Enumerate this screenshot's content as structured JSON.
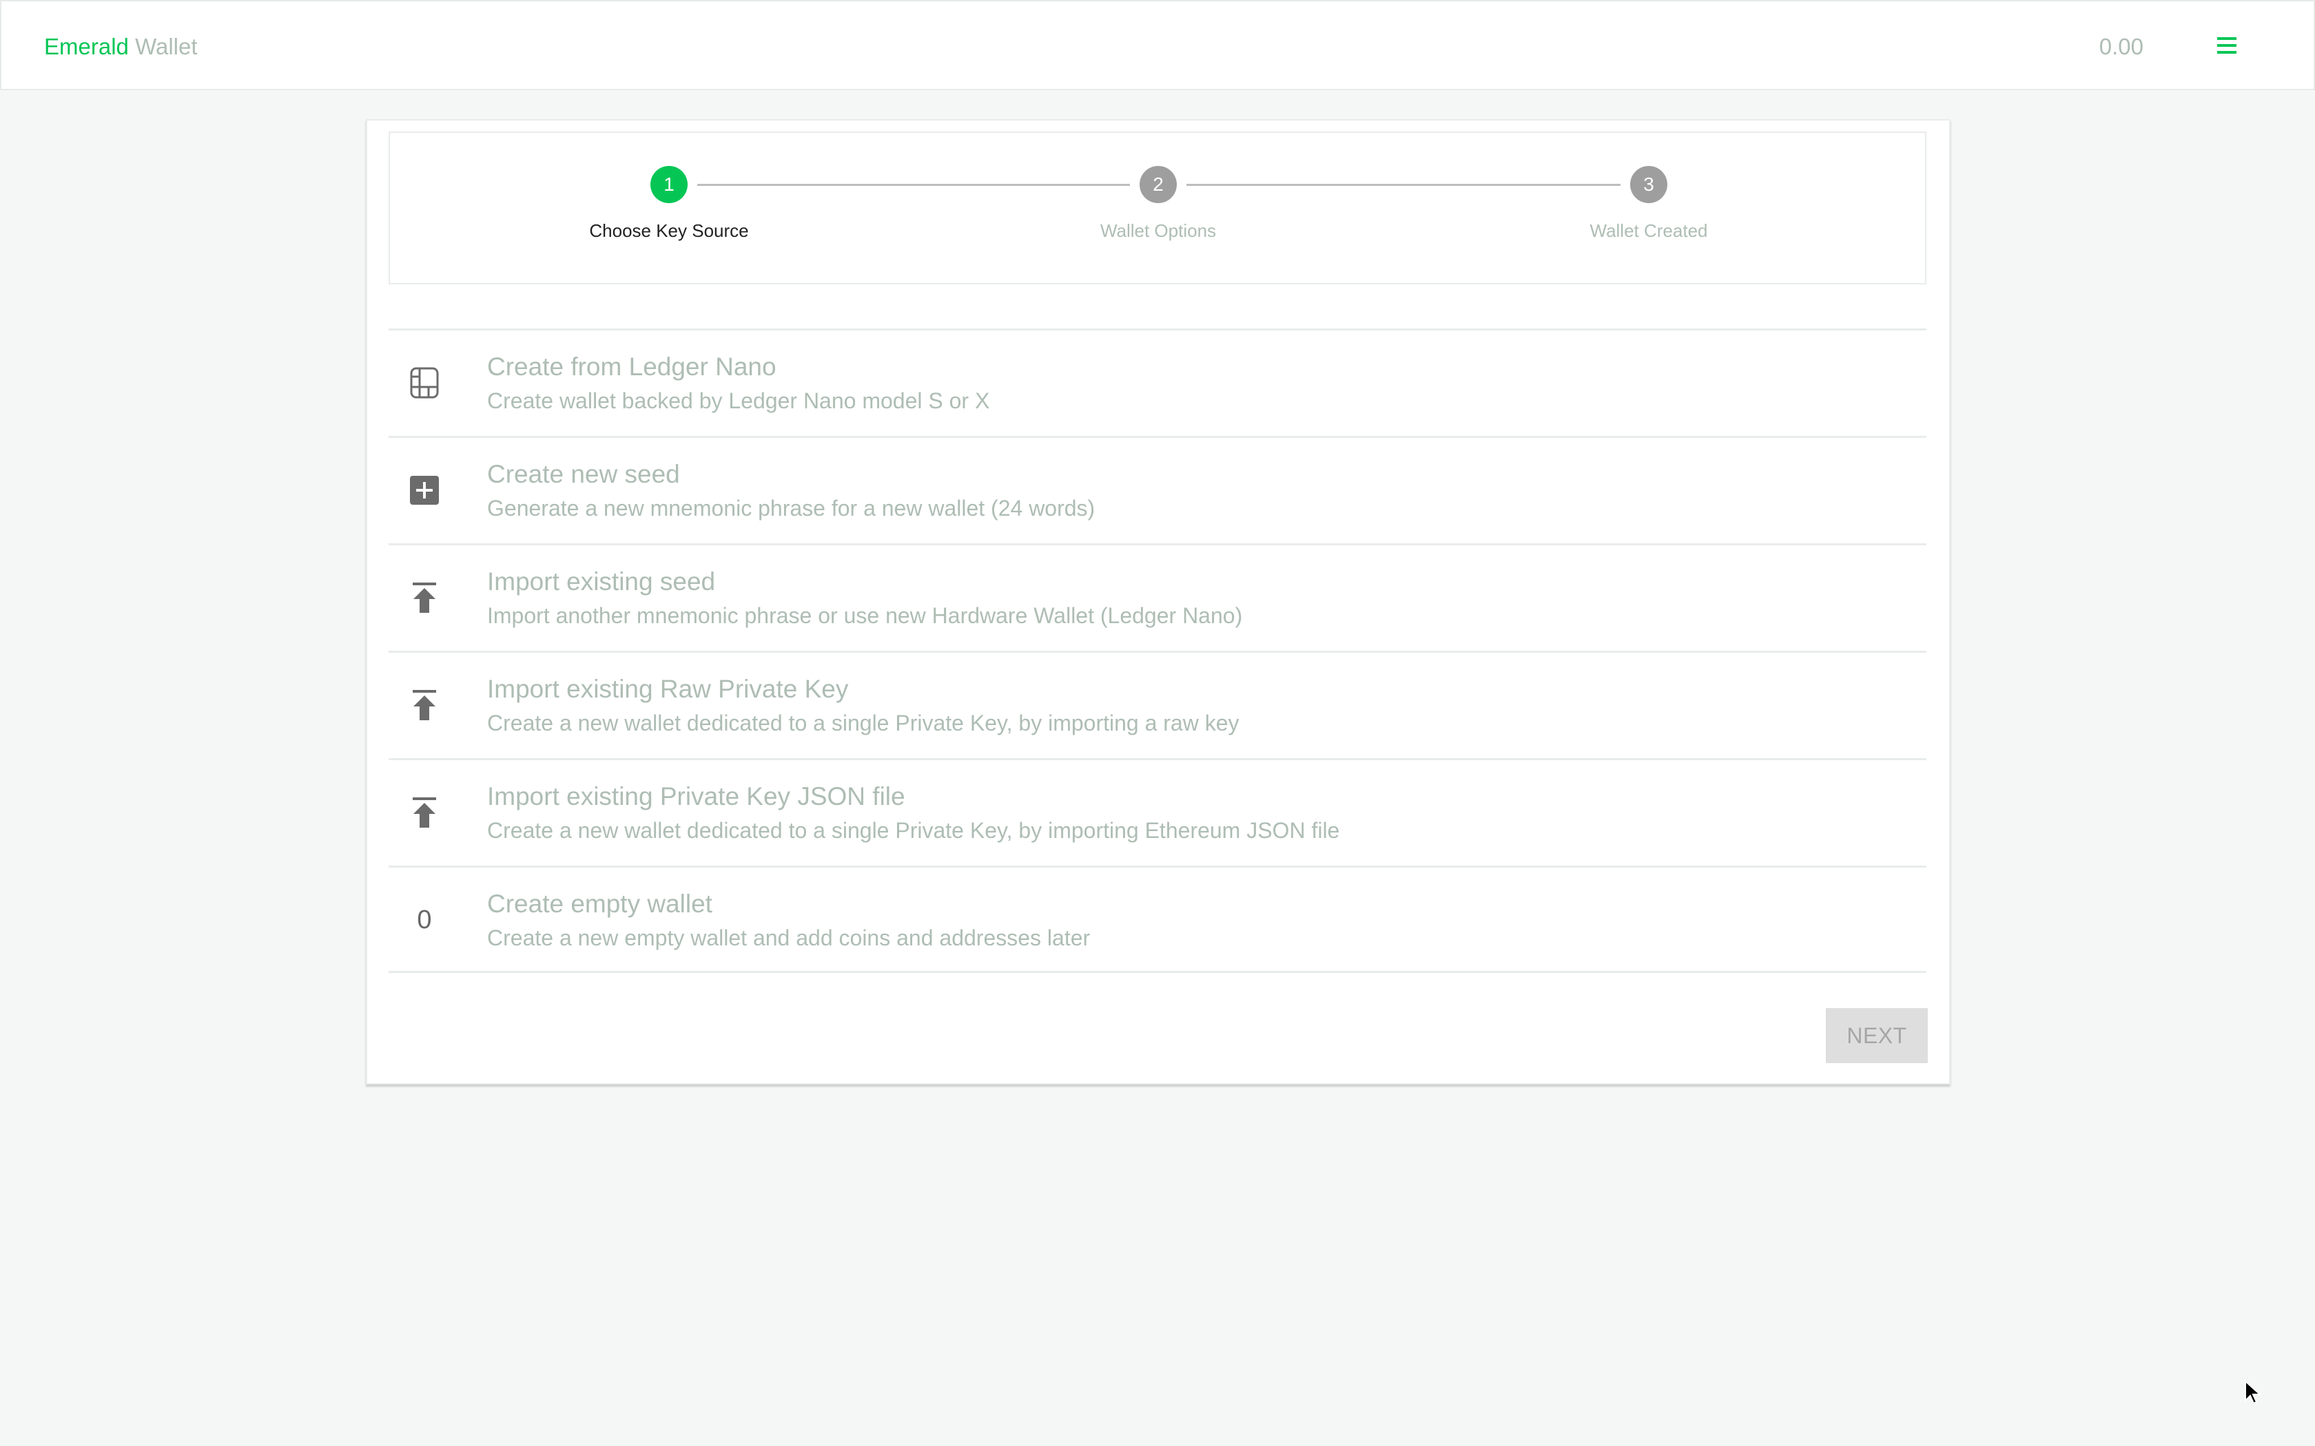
{
  "header": {
    "brand_primary": "Emerald",
    "brand_secondary": "Wallet",
    "balance": "0.00",
    "menu_icon": "hamburger-menu-icon"
  },
  "colors": {
    "accent": "#05c655",
    "muted_text": "#aebdb4",
    "step_inactive": "#9e9e9e",
    "icon": "#6b6b6b",
    "background": "#f5f7f6"
  },
  "stepper": {
    "active_step": 1,
    "steps": [
      {
        "number": "1",
        "label": "Choose Key Source",
        "active": true
      },
      {
        "number": "2",
        "label": "Wallet Options",
        "active": false
      },
      {
        "number": "3",
        "label": "Wallet Created",
        "active": false
      }
    ]
  },
  "options": [
    {
      "icon": "ledger-icon",
      "title": "Create from Ledger Nano",
      "description": "Create wallet backed by Ledger Nano model S or X"
    },
    {
      "icon": "add-box-icon",
      "title": "Create new seed",
      "description": "Generate a new mnemonic phrase for a new wallet (24 words)"
    },
    {
      "icon": "upload-icon",
      "title": "Import existing seed",
      "description": "Import another mnemonic phrase or use new Hardware Wallet (Ledger Nano)"
    },
    {
      "icon": "upload-icon",
      "title": "Import existing Raw Private Key",
      "description": "Create a new wallet dedicated to a single Private Key, by importing a raw key"
    },
    {
      "icon": "upload-icon",
      "title": "Import existing Private Key JSON file",
      "description": "Create a new wallet dedicated to a single Private Key, by importing Ethereum JSON file"
    },
    {
      "icon": "zero-icon",
      "icon_text": "0",
      "title": "Create empty wallet",
      "description": "Create a new empty wallet and add coins and addresses later"
    }
  ],
  "actions": {
    "next_label": "NEXT",
    "next_disabled": true
  }
}
